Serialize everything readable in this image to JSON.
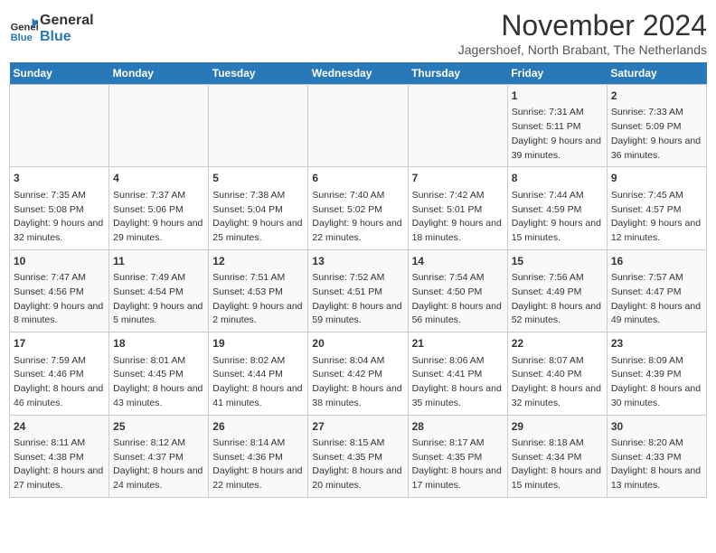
{
  "logo": {
    "line1": "General",
    "line2": "Blue"
  },
  "title": "November 2024",
  "subtitle": "Jagershoef, North Brabant, The Netherlands",
  "days_of_week": [
    "Sunday",
    "Monday",
    "Tuesday",
    "Wednesday",
    "Thursday",
    "Friday",
    "Saturday"
  ],
  "weeks": [
    [
      {
        "day": "",
        "info": ""
      },
      {
        "day": "",
        "info": ""
      },
      {
        "day": "",
        "info": ""
      },
      {
        "day": "",
        "info": ""
      },
      {
        "day": "",
        "info": ""
      },
      {
        "day": "1",
        "info": "Sunrise: 7:31 AM\nSunset: 5:11 PM\nDaylight: 9 hours and 39 minutes."
      },
      {
        "day": "2",
        "info": "Sunrise: 7:33 AM\nSunset: 5:09 PM\nDaylight: 9 hours and 36 minutes."
      }
    ],
    [
      {
        "day": "3",
        "info": "Sunrise: 7:35 AM\nSunset: 5:08 PM\nDaylight: 9 hours and 32 minutes."
      },
      {
        "day": "4",
        "info": "Sunrise: 7:37 AM\nSunset: 5:06 PM\nDaylight: 9 hours and 29 minutes."
      },
      {
        "day": "5",
        "info": "Sunrise: 7:38 AM\nSunset: 5:04 PM\nDaylight: 9 hours and 25 minutes."
      },
      {
        "day": "6",
        "info": "Sunrise: 7:40 AM\nSunset: 5:02 PM\nDaylight: 9 hours and 22 minutes."
      },
      {
        "day": "7",
        "info": "Sunrise: 7:42 AM\nSunset: 5:01 PM\nDaylight: 9 hours and 18 minutes."
      },
      {
        "day": "8",
        "info": "Sunrise: 7:44 AM\nSunset: 4:59 PM\nDaylight: 9 hours and 15 minutes."
      },
      {
        "day": "9",
        "info": "Sunrise: 7:45 AM\nSunset: 4:57 PM\nDaylight: 9 hours and 12 minutes."
      }
    ],
    [
      {
        "day": "10",
        "info": "Sunrise: 7:47 AM\nSunset: 4:56 PM\nDaylight: 9 hours and 8 minutes."
      },
      {
        "day": "11",
        "info": "Sunrise: 7:49 AM\nSunset: 4:54 PM\nDaylight: 9 hours and 5 minutes."
      },
      {
        "day": "12",
        "info": "Sunrise: 7:51 AM\nSunset: 4:53 PM\nDaylight: 9 hours and 2 minutes."
      },
      {
        "day": "13",
        "info": "Sunrise: 7:52 AM\nSunset: 4:51 PM\nDaylight: 8 hours and 59 minutes."
      },
      {
        "day": "14",
        "info": "Sunrise: 7:54 AM\nSunset: 4:50 PM\nDaylight: 8 hours and 56 minutes."
      },
      {
        "day": "15",
        "info": "Sunrise: 7:56 AM\nSunset: 4:49 PM\nDaylight: 8 hours and 52 minutes."
      },
      {
        "day": "16",
        "info": "Sunrise: 7:57 AM\nSunset: 4:47 PM\nDaylight: 8 hours and 49 minutes."
      }
    ],
    [
      {
        "day": "17",
        "info": "Sunrise: 7:59 AM\nSunset: 4:46 PM\nDaylight: 8 hours and 46 minutes."
      },
      {
        "day": "18",
        "info": "Sunrise: 8:01 AM\nSunset: 4:45 PM\nDaylight: 8 hours and 43 minutes."
      },
      {
        "day": "19",
        "info": "Sunrise: 8:02 AM\nSunset: 4:44 PM\nDaylight: 8 hours and 41 minutes."
      },
      {
        "day": "20",
        "info": "Sunrise: 8:04 AM\nSunset: 4:42 PM\nDaylight: 8 hours and 38 minutes."
      },
      {
        "day": "21",
        "info": "Sunrise: 8:06 AM\nSunset: 4:41 PM\nDaylight: 8 hours and 35 minutes."
      },
      {
        "day": "22",
        "info": "Sunrise: 8:07 AM\nSunset: 4:40 PM\nDaylight: 8 hours and 32 minutes."
      },
      {
        "day": "23",
        "info": "Sunrise: 8:09 AM\nSunset: 4:39 PM\nDaylight: 8 hours and 30 minutes."
      }
    ],
    [
      {
        "day": "24",
        "info": "Sunrise: 8:11 AM\nSunset: 4:38 PM\nDaylight: 8 hours and 27 minutes."
      },
      {
        "day": "25",
        "info": "Sunrise: 8:12 AM\nSunset: 4:37 PM\nDaylight: 8 hours and 24 minutes."
      },
      {
        "day": "26",
        "info": "Sunrise: 8:14 AM\nSunset: 4:36 PM\nDaylight: 8 hours and 22 minutes."
      },
      {
        "day": "27",
        "info": "Sunrise: 8:15 AM\nSunset: 4:35 PM\nDaylight: 8 hours and 20 minutes."
      },
      {
        "day": "28",
        "info": "Sunrise: 8:17 AM\nSunset: 4:35 PM\nDaylight: 8 hours and 17 minutes."
      },
      {
        "day": "29",
        "info": "Sunrise: 8:18 AM\nSunset: 4:34 PM\nDaylight: 8 hours and 15 minutes."
      },
      {
        "day": "30",
        "info": "Sunrise: 8:20 AM\nSunset: 4:33 PM\nDaylight: 8 hours and 13 minutes."
      }
    ]
  ]
}
